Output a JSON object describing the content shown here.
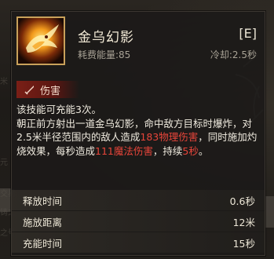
{
  "skill": {
    "name": "金乌幻影",
    "hotkey": "[E]",
    "cost_label": "耗费能量:",
    "cost_value": "85",
    "cooldown_label": "冷却:",
    "cooldown_value": "2.5秒",
    "icon": "golden-crow-icon"
  },
  "tag": {
    "label": "伤害",
    "icon": "sword-icon",
    "color": "#7a1f16"
  },
  "description": {
    "line1": "该技能可充能3次。",
    "p2_a": "朝正前方射出一道金乌幻影，命中敌方目标时爆炸，对2.5米半径范围内的敌人造成",
    "p2_hl1": "183物理伤害",
    "p2_b": "，同时施加灼烧效果，每秒造成",
    "p2_hl2": "111魔法伤害",
    "p2_c": "，持续",
    "p2_hl3": "5秒",
    "p2_d": "。"
  },
  "stats": [
    {
      "label": "释放时间",
      "value": "0.6秒"
    },
    {
      "label": "施放距离",
      "value": "12米"
    },
    {
      "label": "充能时间",
      "value": "15秒"
    }
  ],
  "colors": {
    "highlight": "#e8453a",
    "frame_gold": "#c9a15a",
    "text": "#f1ece0"
  }
}
